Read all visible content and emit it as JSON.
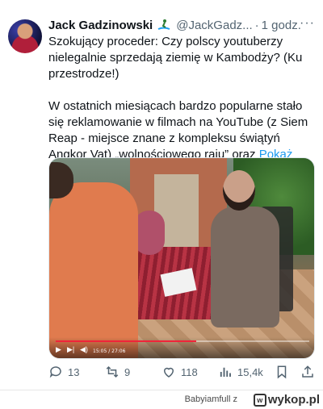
{
  "tweet": {
    "author_name": "Jack Gadzinowski",
    "badge_icon": "surfer-emoji",
    "handle": "@JackGadz...",
    "separator": "·",
    "time": "1 godz.",
    "more_icon": "more-dots-icon",
    "paragraph1": "Szokujący proceder: Czy polscy youtuberzy nielegalnie sprzedają ziemię w Kambodży? (Ku przestrodze!)",
    "paragraph2": "W ostatnich miesiącach bardzo popularne stało się reklamowanie w filmach na YouTube (z Siem Reap - miejsce znane z kompleksu świątyń Angkor Vat) „wolnościowego raju” oraz",
    "show_more": "Pokaż więcej",
    "video": {
      "time": "15:05 / 27:06",
      "progress": 0.555,
      "progress_color": "#f0243a"
    },
    "actions": {
      "replies": "13",
      "retweets": "9",
      "likes": "118",
      "views": "15,4k"
    },
    "accent_color": "#1d9bf0"
  },
  "footer": {
    "user": "Babyiamfull",
    "prefix": "z",
    "site": "wykop.pl"
  }
}
